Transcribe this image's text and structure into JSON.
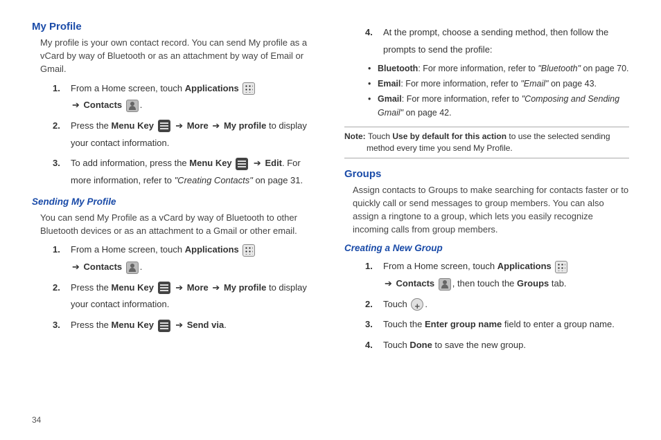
{
  "left": {
    "myProfile": {
      "heading": "My Profile",
      "intro": "My profile is your own contact record. You can send My profile as a vCard by way of Bluetooth or as an attachment by way of Email or Gmail.",
      "step1_pre": "From a Home screen, touch ",
      "applications": "Applications",
      "arrow": "➔",
      "contacts": "Contacts",
      "period": ".",
      "step2_pre": "Press the ",
      "menuKey": "Menu Key",
      "more": "More",
      "myProfile": "My profile",
      "step2_post": " to display your contact information.",
      "step3_pre": "To add information, press the ",
      "edit": "Edit",
      "step3_mid": ". For more information, refer to ",
      "step3_ref": "\"Creating Contacts\"",
      "step3_post": " on page 31."
    },
    "sending": {
      "heading": "Sending My Profile",
      "intro": "You can send My Profile as a vCard by way of Bluetooth to other Bluetooth devices or as an attachment to a Gmail or other email.",
      "step3_pre": "Press the ",
      "sendVia": "Send via",
      "period2": "."
    }
  },
  "right": {
    "step4_pre": "At the prompt, choose a sending method, then follow the prompts to send the profile:",
    "bt_label": "Bluetooth",
    "bt_text": ": For more information, refer to ",
    "bt_ref": "\"Bluetooth\"",
    "bt_post": " on page 70.",
    "em_label": "Email",
    "em_text": ": For more information, refer to ",
    "em_ref": "\"Email\"",
    "em_post": " on page 43.",
    "gm_label": "Gmail",
    "gm_text": ": For more information, refer to ",
    "gm_ref": "\"Composing and Sending Gmail\"",
    "gm_post": " on page 42.",
    "note_pre": "Note: ",
    "note_mid1": "Touch ",
    "note_bold": "Use by default for this action",
    "note_mid2": " to use the selected sending method every time you send My Profile.",
    "groups": {
      "heading": "Groups",
      "intro": "Assign contacts to Groups to make searching for contacts faster or to quickly call or send messages to group members. You can also assign a ringtone to a group, which lets you easily recognize incoming calls from group members.",
      "creating": "Creating a New Group",
      "step1_post": ", then touch the ",
      "groupsTab": "Groups",
      "step1_post2": " tab.",
      "step2_pre": "Touch ",
      "step3_pre": "Touch the ",
      "enterGroup": "Enter group name",
      "step3_post": " field to enter a group name.",
      "step4_pre": "Touch ",
      "done": "Done",
      "step4_post": " to save the new group."
    }
  },
  "nums": {
    "n1": "1.",
    "n2": "2.",
    "n3": "3.",
    "n4": "4."
  },
  "pageNumber": "34"
}
